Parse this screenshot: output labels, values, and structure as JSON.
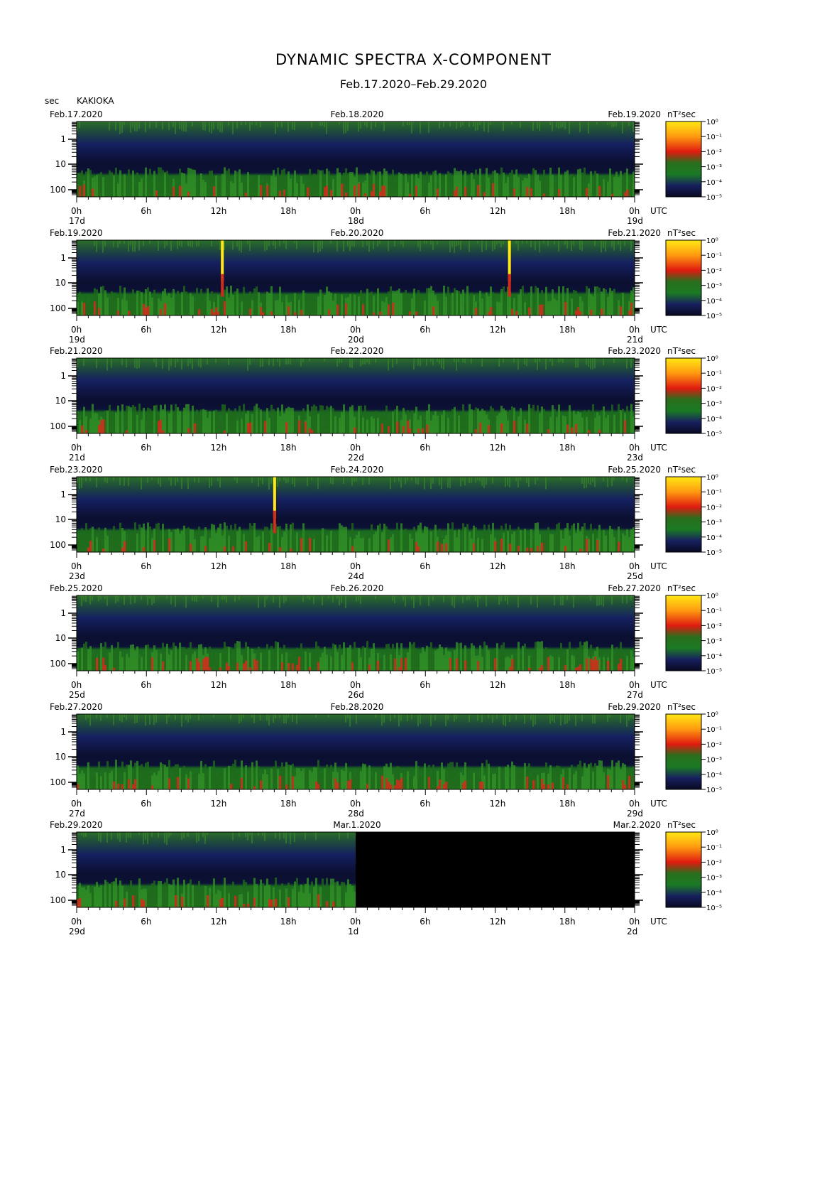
{
  "title": "DYNAMIC SPECTRA X-COMPONENT",
  "subtitle": "Feb.17.2020–Feb.29.2020",
  "y_unit": "sec",
  "station": "KAKIOKA",
  "colorbar_unit": "nT²sec",
  "colorbar_ticks": [
    "10⁰",
    "10⁻¹",
    "10⁻²",
    "10⁻³",
    "10⁻⁴",
    "10⁻⁵"
  ],
  "hour_ticks": [
    "0h",
    "6h",
    "12h",
    "18h",
    "0h",
    "6h",
    "12h",
    "18h",
    "0h"
  ],
  "utc_label": "UTC",
  "colors": {
    "dark": "#0a0d2a",
    "blue": "#141d5a",
    "green": "#1f7a1f",
    "red": "#d42a1a",
    "yellow": "#ffe814"
  },
  "chart_data": {
    "type": "heatmap",
    "title": "DYNAMIC SPECTRA X-COMPONENT",
    "subtitle": "Feb.17.2020–Feb.29.2020",
    "y_axis": {
      "label": "sec",
      "scale": "log",
      "ticks": [
        "1",
        "10",
        "100"
      ]
    },
    "x_axis": {
      "ticks": [
        "0h",
        "6h",
        "12h",
        "18h",
        "0h",
        "6h",
        "12h",
        "18h",
        "0h"
      ],
      "label": "UTC"
    },
    "colorbar": {
      "unit": "nT²sec",
      "scale": "log",
      "range": [
        1e-05,
        1
      ]
    },
    "panels": [
      {
        "left_date": "Feb.17.2020",
        "mid_date": "Feb.18.2020",
        "right_date": "Feb.19.2020",
        "day_labels": [
          "17d",
          "18d",
          "19d"
        ],
        "spikes": [],
        "data_hours": 48
      },
      {
        "left_date": "Feb.19.2020",
        "mid_date": "Feb.20.2020",
        "right_date": "Feb.21.2020",
        "day_labels": [
          "19d",
          "20d",
          "21d"
        ],
        "spikes": [
          12.5,
          37.2
        ],
        "data_hours": 48
      },
      {
        "left_date": "Feb.21.2020",
        "mid_date": "Feb.22.2020",
        "right_date": "Feb.23.2020",
        "day_labels": [
          "21d",
          "22d",
          "23d"
        ],
        "spikes": [],
        "data_hours": 48
      },
      {
        "left_date": "Feb.23.2020",
        "mid_date": "Feb.24.2020",
        "right_date": "Feb.25.2020",
        "day_labels": [
          "23d",
          "24d",
          "25d"
        ],
        "spikes": [
          17.0
        ],
        "data_hours": 48
      },
      {
        "left_date": "Feb.25.2020",
        "mid_date": "Feb.26.2020",
        "right_date": "Feb.27.2020",
        "day_labels": [
          "25d",
          "26d",
          "27d"
        ],
        "spikes": [],
        "data_hours": 48
      },
      {
        "left_date": "Feb.27.2020",
        "mid_date": "Feb.28.2020",
        "right_date": "Feb.29.2020",
        "day_labels": [
          "27d",
          "28d",
          "29d"
        ],
        "spikes": [],
        "data_hours": 48
      },
      {
        "left_date": "Feb.29.2020",
        "mid_date": "Mar.1.2020",
        "right_date": "Mar.2.2020",
        "day_labels": [
          "29d",
          "1d",
          "2d"
        ],
        "spikes": [],
        "data_hours": 24
      }
    ]
  }
}
